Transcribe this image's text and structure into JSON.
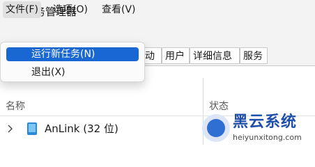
{
  "window": {
    "title": "任务管理器",
    "icon": "task-manager-icon"
  },
  "menubar": {
    "file": "文件(F)",
    "options": "选项(O)",
    "view": "查看(V)"
  },
  "tabs": {
    "startup_partial": "动",
    "users": "用户",
    "details": "详细信息",
    "services": "服务"
  },
  "dropdown": {
    "run_new_task": "运行新任务(N)",
    "exit": "退出(X)"
  },
  "columns": {
    "name": "名称",
    "status": "状态"
  },
  "rows": [
    {
      "label": "AnLink (32 位)",
      "icon": "app-icon"
    }
  ],
  "watermark": {
    "title": "黑云系统",
    "url": "heiyunxitong.com"
  },
  "colors": {
    "accent": "#1967d2",
    "titlebar_bg": "#f3f3f3",
    "watermark_blue": "#1f4fa8"
  }
}
